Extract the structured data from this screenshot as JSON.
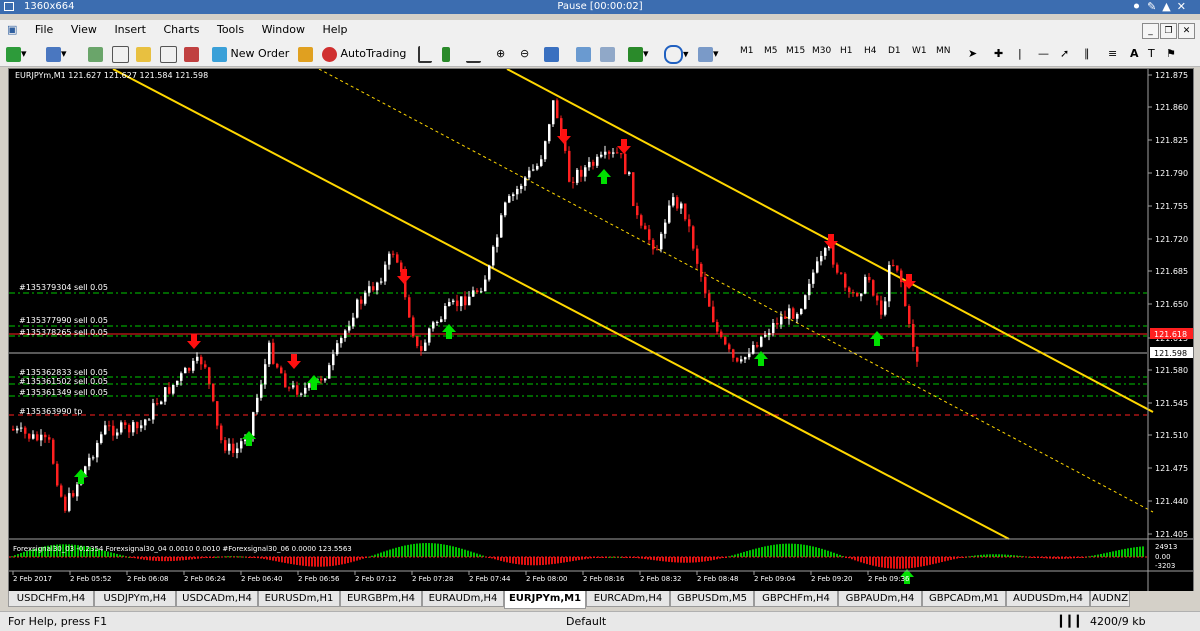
{
  "window": {
    "title": "1360x664",
    "center_title": "Pause [00:00:02]"
  },
  "menu": {
    "items": [
      "File",
      "View",
      "Insert",
      "Charts",
      "Tools",
      "Window",
      "Help"
    ]
  },
  "toolbar": {
    "new_order": "New Order",
    "autotrading": "AutoTrading",
    "timeframes": [
      "M1",
      "M5",
      "M15",
      "M30",
      "H1",
      "H4",
      "D1",
      "W1",
      "MN"
    ]
  },
  "chart": {
    "header": "EURJPYm,M1  121.627 121.627 121.584 121.598",
    "current_price": "121.598",
    "bid_label": "121.618",
    "price_ticks": [
      "121.875",
      "121.860",
      "121.825",
      "121.790",
      "121.755",
      "121.720",
      "121.685",
      "121.650",
      "121.615",
      "121.580",
      "121.545",
      "121.510",
      "121.475",
      "121.440",
      "121.405"
    ],
    "time_ticks": [
      "2 Feb 2017",
      "2 Feb 05:52",
      "2 Feb 06:08",
      "2 Feb 06:24",
      "2 Feb 06:40",
      "2 Feb 06:56",
      "2 Feb 07:12",
      "2 Feb 07:28",
      "2 Feb 07:44",
      "2 Feb 08:00",
      "2 Feb 08:16",
      "2 Feb 08:32",
      "2 Feb 08:48",
      "2 Feb 09:04",
      "2 Feb 09:20",
      "2 Feb 09:36"
    ],
    "order_labels": [
      "#135379304 sell 0.05",
      "#135377990 sell 0.05",
      "#135378265 sell 0.05",
      "#135362833 sell 0.05",
      "#135361502 sell 0.05",
      "#135361349 sell 0.05",
      "#135363990 tp"
    ],
    "indicator_label": "Forexsignal30_03 -0.2354  Forexsignal30_04 0.0010 0.0010  #Forexsignal30_06 0.0000 123.5563",
    "indicator_ticks": [
      "24913",
      "0.00",
      "-3203"
    ],
    "colors": {
      "up_candle": "#ffffff",
      "down_candle": "#ff0000",
      "channel": "#ffd700",
      "order_line": "#00c800",
      "tp_line": "#ff0000"
    }
  },
  "tabs": [
    "USDCHFm,H4",
    "USDJPYm,H4",
    "USDCADm,H4",
    "EURUSDm,H1",
    "EURGBPm,H4",
    "EURAUDm,H4",
    "EURJPYm,M1",
    "EURCADm,H4",
    "GBPUSDm,M5",
    "GBPCHFm,H4",
    "GBPAUDm,H4",
    "GBPCADm,M1",
    "AUDUSDm,H4",
    "AUDNZ"
  ],
  "active_tab": "EURJPYm,M1",
  "status": {
    "help": "For Help, press F1",
    "profile": "Default",
    "traffic": "4200/9 kb"
  }
}
